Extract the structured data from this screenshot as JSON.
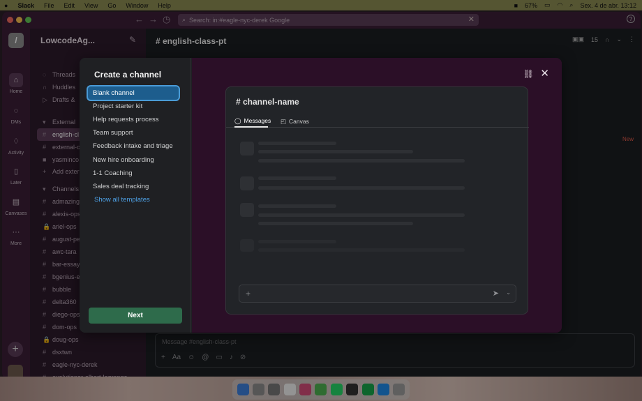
{
  "menubar": {
    "app": "Slack",
    "items": [
      "File",
      "Edit",
      "View",
      "Go",
      "Window",
      "Help"
    ],
    "battery": "67%",
    "datetime": "Sex. 4 de abr.  13:12"
  },
  "topbar": {
    "search_placeholder": "Search: in:#eagle-nyc-derek Google"
  },
  "rail": {
    "items": [
      {
        "label": "Home",
        "icon": "home-icon"
      },
      {
        "label": "DMs",
        "icon": "dms-icon"
      },
      {
        "label": "Activity",
        "icon": "bell-icon"
      },
      {
        "label": "Later",
        "icon": "bookmark-icon"
      },
      {
        "label": "Canvases",
        "icon": "canvas-icon"
      },
      {
        "label": "More",
        "icon": "more-icon"
      }
    ]
  },
  "sidebar": {
    "workspace": "LowcodeAg...",
    "items": [
      {
        "glyph": "◌",
        "label": "Threads"
      },
      {
        "glyph": "∩",
        "label": "Huddles"
      },
      {
        "glyph": "▷",
        "label": "Drafts &"
      },
      {
        "glyph": "▾",
        "label": "External"
      },
      {
        "glyph": "#",
        "label": "english-cl"
      },
      {
        "glyph": "#",
        "label": "external-c"
      },
      {
        "glyph": "■",
        "label": "yasminco"
      },
      {
        "glyph": "+",
        "label": "Add exter"
      },
      {
        "glyph": "▾",
        "label": "Channels"
      },
      {
        "glyph": "#",
        "label": "admazing"
      },
      {
        "glyph": "#",
        "label": "alexis-ops"
      },
      {
        "glyph": "🔒",
        "label": "ariel-ops"
      },
      {
        "glyph": "#",
        "label": "august-pe"
      },
      {
        "glyph": "#",
        "label": "awc-tara"
      },
      {
        "glyph": "#",
        "label": "bar-essay"
      },
      {
        "glyph": "#",
        "label": "bgenius-e"
      },
      {
        "glyph": "#",
        "label": "bubble"
      },
      {
        "glyph": "#",
        "label": "delta360"
      },
      {
        "glyph": "#",
        "label": "diego-ops"
      },
      {
        "glyph": "#",
        "label": "dom-ops"
      },
      {
        "glyph": "🔒",
        "label": "doug-ops"
      },
      {
        "glyph": "#",
        "label": "dsxtwn"
      },
      {
        "glyph": "#",
        "label": "eagle-nyc-derek"
      },
      {
        "glyph": "#",
        "label": "evolutioner-albert-lagrange"
      },
      {
        "glyph": "#",
        "label": "flutterflow"
      }
    ]
  },
  "channel": {
    "title": "# english-class-pt",
    "member_count": "15",
    "new_label": "New",
    "composer_placeholder": "Message #english-class-pt"
  },
  "modal": {
    "title": "Create a channel",
    "templates": [
      "Blank channel",
      "Project starter kit",
      "Help requests process",
      "Team support",
      "Feedback intake and triage",
      "New hire onboarding",
      "1-1 Coaching",
      "Sales deal tracking"
    ],
    "show_all": "Show all templates",
    "next_label": "Next",
    "preview": {
      "channel_name": "# channel-name",
      "tabs": [
        "Messages",
        "Canvas"
      ]
    }
  }
}
